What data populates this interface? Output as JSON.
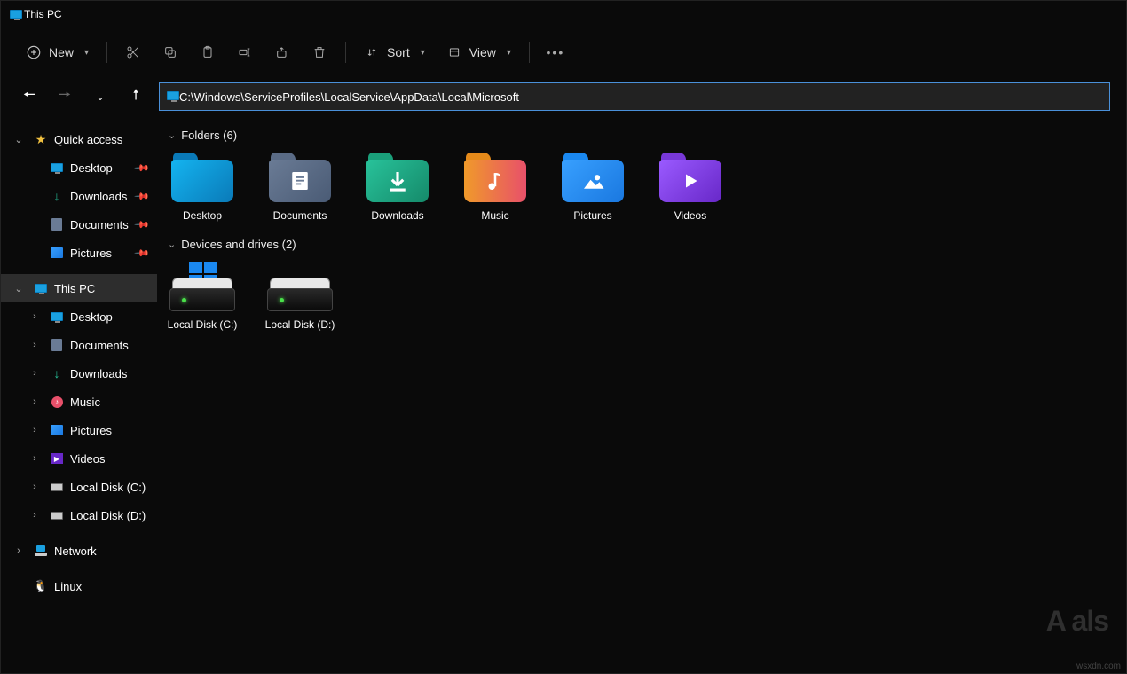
{
  "window_title": "This PC",
  "toolbar": {
    "new_label": "New",
    "sort_label": "Sort",
    "view_label": "View"
  },
  "address_path": "C:\\Windows\\ServiceProfiles\\LocalService\\AppData\\Local\\Microsoft",
  "sidebar": {
    "quick_access": {
      "label": "Quick access"
    },
    "qa_items": [
      {
        "label": "Desktop",
        "icon": "monitor",
        "pinned": true
      },
      {
        "label": "Downloads",
        "icon": "dl",
        "pinned": true
      },
      {
        "label": "Documents",
        "icon": "doc",
        "pinned": true
      },
      {
        "label": "Pictures",
        "icon": "pic",
        "pinned": true
      }
    ],
    "this_pc": {
      "label": "This PC"
    },
    "pc_items": [
      {
        "label": "Desktop",
        "icon": "monitor"
      },
      {
        "label": "Documents",
        "icon": "doc"
      },
      {
        "label": "Downloads",
        "icon": "dl"
      },
      {
        "label": "Music",
        "icon": "music"
      },
      {
        "label": "Pictures",
        "icon": "pic"
      },
      {
        "label": "Videos",
        "icon": "video"
      },
      {
        "label": "Local Disk (C:)",
        "icon": "drive"
      },
      {
        "label": "Local Disk (D:)",
        "icon": "drive"
      }
    ],
    "network": {
      "label": "Network"
    },
    "linux": {
      "label": "Linux"
    }
  },
  "sections": {
    "folders": {
      "header": "Folders (6)"
    },
    "drives": {
      "header": "Devices and drives (2)"
    }
  },
  "folders": [
    {
      "label": "Desktop",
      "kind": "desktop"
    },
    {
      "label": "Documents",
      "kind": "documents"
    },
    {
      "label": "Downloads",
      "kind": "downloads"
    },
    {
      "label": "Music",
      "kind": "music"
    },
    {
      "label": "Pictures",
      "kind": "pictures"
    },
    {
      "label": "Videos",
      "kind": "videos"
    }
  ],
  "drives": [
    {
      "label": "Local Disk (C:)",
      "os": true
    },
    {
      "label": "Local Disk (D:)",
      "os": false
    }
  ],
  "watermark": "wsxdn.com",
  "logo_watermark": "A   als"
}
